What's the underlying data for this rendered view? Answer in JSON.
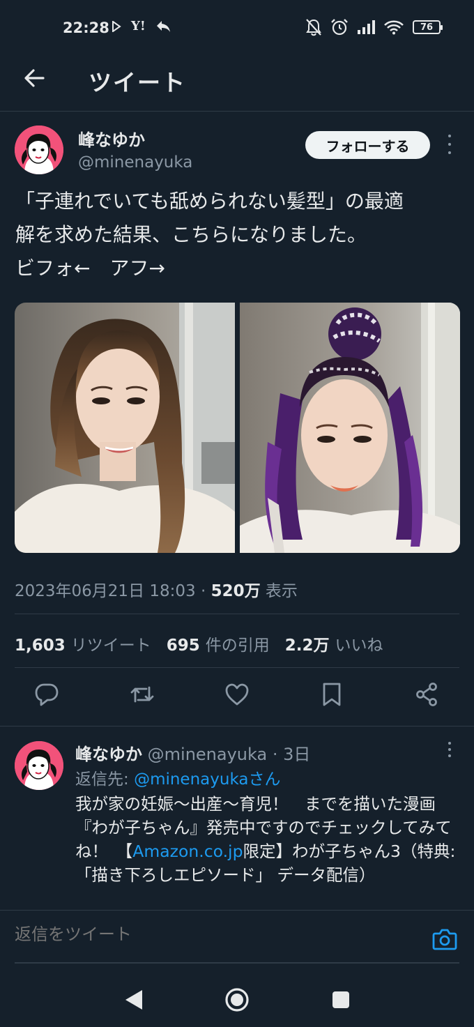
{
  "status_bar": {
    "time": "22:28",
    "yahoo": "Y!",
    "battery": "76"
  },
  "header": {
    "title": "ツイート"
  },
  "tweet": {
    "author_name": "峰なゆか",
    "author_handle": "@minenayuka",
    "follow_label": "フォローする",
    "text": "「子連れでいても舐められない髪型」の最適\n解を求めた結果、こちらになりました。\nビフォ←　アフ→",
    "timestamp": "2023年06月21日 18:03 · ",
    "views_count": "520万",
    "views_label": "表示",
    "retweets_count": "1,603",
    "retweets_label": "リツイート",
    "quotes_count": "695",
    "quotes_label": "件の引用",
    "likes_count": "2.2万",
    "likes_label": "いいね"
  },
  "reply": {
    "author_name": "峰なゆか",
    "author_handle": "@minenayuka",
    "age": "· 3日",
    "reply_to_prefix": "返信先: ",
    "reply_to_handle": "@minenayukaさん",
    "text_before_link": "我が家の妊娠〜出産〜育児！　までを描いた漫画『わが子ちゃん』発売中ですのでチェックしてみてね！　【",
    "link_text": "Amazon.co.jp",
    "text_after_link": "限定】わが子ちゃん3（特典:「描き下ろしエピソード」 データ配信）"
  },
  "composer": {
    "placeholder": "返信をツイート"
  },
  "colors": {
    "background": "#15202b",
    "accent": "#1d9bf0",
    "muted": "#8b98a5",
    "avatar_bg": "#f2527a"
  }
}
